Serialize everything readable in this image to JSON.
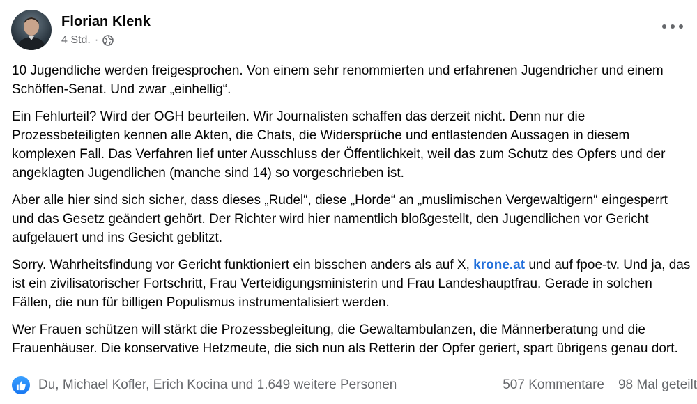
{
  "post": {
    "author": "Florian Klenk",
    "time": "4 Std.",
    "separator": "·",
    "paragraphs": {
      "p1": "10 Jugendliche werden freigesprochen. Von einem sehr renommierten und erfahrenen Jugendricher und einem Schöffen-Senat. Und zwar „einhellig“.",
      "p2": "Ein Fehlurteil? Wird der OGH beurteilen. Wir Journalisten schaffen das derzeit nicht. Denn nur die Prozessbeteiligten kennen alle Akten, die Chats, die Widersprüche und entlastenden Aussagen in diesem komplexen Fall. Das Verfahren lief unter Ausschluss der Öffentlichkeit, weil das zum Schutz des Opfers und der angeklagten Jugendlichen (manche sind 14) so vorgeschrieben ist.",
      "p3": "Aber alle hier sind sich sicher, dass dieses „Rudel“, diese „Horde“ an „muslimischen Vergewaltigern“ eingesperrt und das Gesetz geändert gehört. Der Richter wird hier namentlich bloßgestellt, den Jugendlichen vor Gericht aufgelauert und ins Gesicht geblitzt.",
      "p4_before": "Sorry. Wahrheitsfindung vor Gericht funktioniert ein bisschen anders als auf X, ",
      "p4_link": "krone.at",
      "p4_after": " und auf fpoe-tv. Und ja, das ist ein zivilisatorischer Fortschritt, Frau Verteidigungsministerin und Frau Landeshauptfrau. Gerade in solchen Fällen, die nun für billigen Populismus instrumentalisiert werden.",
      "p5": "Wer Frauen schützen will stärkt die Prozessbegleitung, die Gewaltambulanzen, die Männerberatung und die Frauenhäuser. Die konservative Hetzmeute, die sich nun als Retterin der Opfer geriert, spart übrigens genau dort."
    },
    "reactions_text": "Du, Michael Kofler, Erich Kocina und 1.649 weitere Personen",
    "comments": "507 Kommentare",
    "shares": "98 Mal geteilt"
  },
  "icons": {
    "privacy": "globe-icon",
    "menu": "more-dots-icon",
    "reaction": "like-thumb-icon"
  },
  "colors": {
    "text": "#050505",
    "secondary": "#65676b",
    "link": "#216fdb",
    "like": "#1877f2"
  }
}
